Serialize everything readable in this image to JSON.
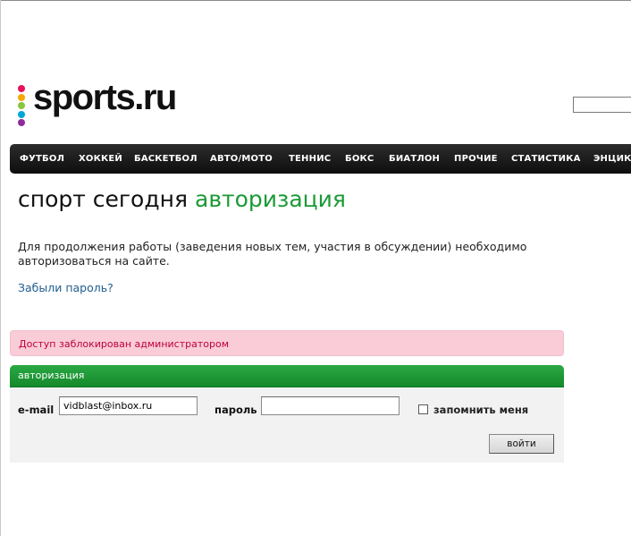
{
  "header": {
    "logo_text": "sports.ru",
    "logo_dot_colors": [
      "#e8115c",
      "#f5a800",
      "#8bc53f",
      "#00a6d8",
      "#8e2c9a"
    ]
  },
  "nav": {
    "items": [
      "ФУТБОЛ",
      "ХОККЕЙ",
      "БАСКЕТБОЛ",
      "АВТО/МОТО",
      "ТЕННИС",
      "БОКС",
      "БИАТЛОН",
      "ПРОЧИЕ",
      "СТАТИСТИКА",
      "ЭНЦИКЛ"
    ]
  },
  "page": {
    "title_main": "спорт сегодня",
    "title_sub": "авторизация",
    "intro": "Для продолжения работы (заведения новых тем, участия в обсуждении) необходимо авторизоваться на сайте.",
    "forgot_link": "Забыли пароль?"
  },
  "error": {
    "message": "Доступ заблокирован администратором"
  },
  "login": {
    "panel_title": "авторизация",
    "email_label": "e-mail",
    "email_value": "vidblast@inbox.ru",
    "password_label": "пароль",
    "password_value": "",
    "remember_label": "запомнить меня",
    "remember_checked": false,
    "submit_label": "войти"
  },
  "colors": {
    "accent_green": "#1b9a35",
    "nav_bg": "#1a1a1a",
    "error_bg": "#f9ccd8",
    "link": "#1f5d8f"
  }
}
